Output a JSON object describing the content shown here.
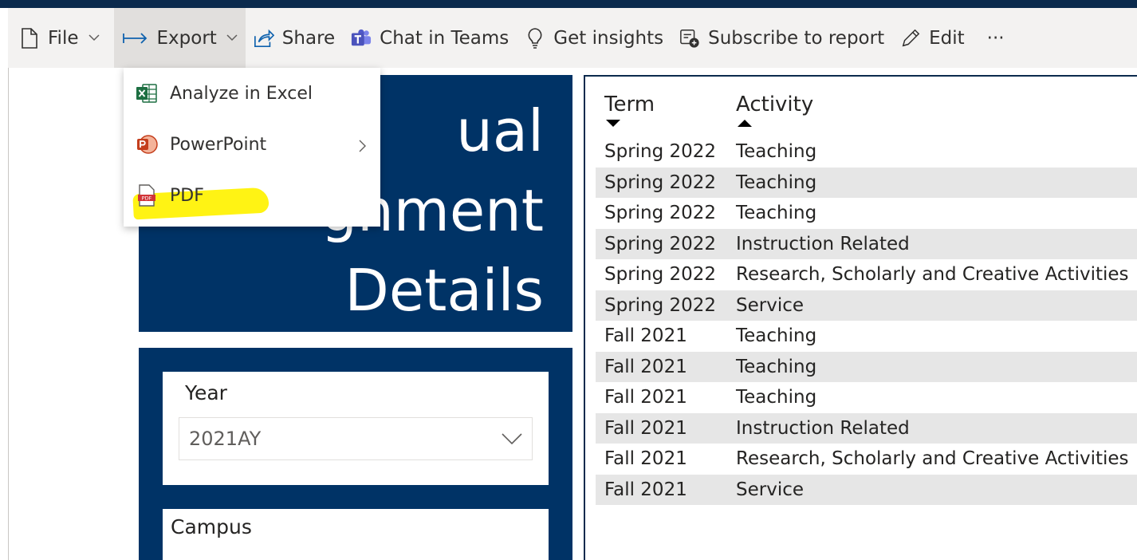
{
  "toolbar": {
    "file": "File",
    "export": "Export",
    "share": "Share",
    "chat": "Chat in Teams",
    "insights": "Get insights",
    "subscribe": "Subscribe to report",
    "edit": "Edit",
    "more": "···"
  },
  "export_menu": {
    "items": [
      {
        "label": "Analyze in Excel",
        "icon": "excel-icon"
      },
      {
        "label": "PowerPoint",
        "icon": "powerpoint-icon",
        "has_submenu": true
      },
      {
        "label": "PDF",
        "icon": "pdf-icon",
        "highlighted": true
      }
    ],
    "highlight_color": "#fff200"
  },
  "report": {
    "title_lines": [
      "ual",
      "gnment",
      "Details"
    ],
    "title_bg": "#003366"
  },
  "filters": {
    "year_label": "Year",
    "year_value": "2021AY",
    "campus_label": "Campus"
  },
  "table": {
    "headers": [
      "Term",
      "Activity"
    ],
    "rows": [
      [
        "Spring 2022",
        "Teaching"
      ],
      [
        "Spring 2022",
        "Teaching"
      ],
      [
        "Spring 2022",
        "Teaching"
      ],
      [
        "Spring 2022",
        "Instruction Related"
      ],
      [
        "Spring 2022",
        "Research, Scholarly and Creative Activities"
      ],
      [
        "Spring 2022",
        "Service"
      ],
      [
        "Fall 2021",
        "Teaching"
      ],
      [
        "Fall 2021",
        "Teaching"
      ],
      [
        "Fall 2021",
        "Teaching"
      ],
      [
        "Fall 2021",
        "Instruction Related"
      ],
      [
        "Fall 2021",
        "Research, Scholarly and Creative Activities"
      ],
      [
        "Fall 2021",
        "Service"
      ]
    ]
  }
}
